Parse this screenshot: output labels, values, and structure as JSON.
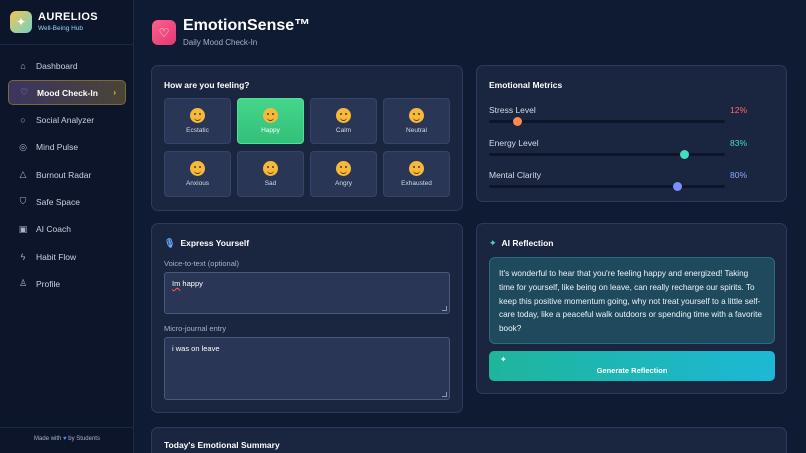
{
  "brand": {
    "name": "AURELIOS",
    "subtitle": "Well-Being Hub",
    "logo_icon": "sparkle-icon"
  },
  "sidebar": {
    "items": [
      {
        "label": "Dashboard",
        "icon": "home-icon",
        "glyph": "⌂"
      },
      {
        "label": "Mood Check-In",
        "icon": "heart-icon",
        "glyph": "♡",
        "active": true
      },
      {
        "label": "Social Analyzer",
        "icon": "chat-bubble-icon",
        "glyph": "○"
      },
      {
        "label": "Mind Pulse",
        "icon": "pulse-icon",
        "glyph": "◎"
      },
      {
        "label": "Burnout Radar",
        "icon": "warning-icon",
        "glyph": "△"
      },
      {
        "label": "Safe Space",
        "icon": "shield-icon",
        "glyph": "⛉"
      },
      {
        "label": "AI Coach",
        "icon": "robot-icon",
        "glyph": "▣"
      },
      {
        "label": "Habit Flow",
        "icon": "lightning-icon",
        "glyph": "ϟ"
      },
      {
        "label": "Profile",
        "icon": "user-icon",
        "glyph": "♙"
      }
    ],
    "footer_prefix": "Made with",
    "footer_suffix": "by Students"
  },
  "header": {
    "title": "EmotionSense™",
    "subtitle": "Daily Mood Check-In",
    "icon": "heart-icon"
  },
  "mood": {
    "title": "How are you feeling?",
    "options": [
      "Ecstatic",
      "Happy",
      "Calm",
      "Neutral",
      "Anxious",
      "Sad",
      "Angry",
      "Exhausted"
    ],
    "selected": "Happy"
  },
  "metrics": {
    "title": "Emotional Metrics",
    "items": [
      {
        "label": "Stress Level",
        "value": "12%",
        "level": 0.12,
        "color": "#ff6b6b",
        "knob": "#ff8a4c"
      },
      {
        "label": "Energy Level",
        "value": "83%",
        "level": 0.83,
        "color": "#3fe0c0",
        "knob": "#3fe0c0"
      },
      {
        "label": "Mental Clarity",
        "value": "80%",
        "level": 0.8,
        "color": "#8aa8ff",
        "knob": "#7a90ff"
      }
    ]
  },
  "express": {
    "title": "Express Yourself",
    "voice_label": "Voice-to-text (optional)",
    "voice_word_flagged": "Im",
    "voice_rest": " happy",
    "journal_label": "Micro-journal entry",
    "journal_value": "i was on leave"
  },
  "reflection": {
    "title": "AI Reflection",
    "text": "It's wonderful to hear that you're feeling happy and energized! Taking time for yourself, like being on leave, can really recharge our spirits. To keep this positive momentum going, why not treat yourself to a little self-care today, like a peaceful walk outdoors or spending time with a favorite book?",
    "button_label": "Generate Reflection"
  },
  "summary": {
    "title": "Today's Emotional Summary"
  }
}
